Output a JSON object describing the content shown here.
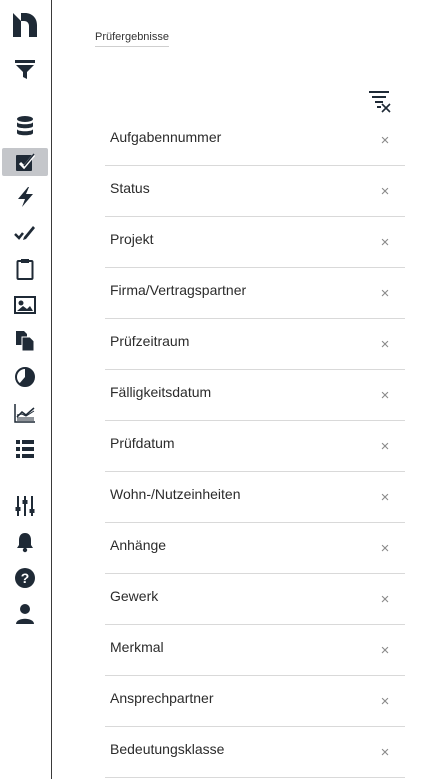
{
  "page": {
    "title": "Prüfergebnisse"
  },
  "icons": {
    "logo": "logo-n-icon",
    "filter": "funnel-filter-icon",
    "database": "database-icon",
    "tasks": "checkbox-icon",
    "lightning": "lightning-icon",
    "pen": "pen-check-icon",
    "clipboard": "clipboard-icon",
    "image": "image-card-icon",
    "documents": "documents-icon",
    "pie": "pie-chart-icon",
    "area": "area-chart-icon",
    "list": "list-icon",
    "sliders": "sliders-icon",
    "bell": "bell-icon",
    "help": "help-icon",
    "user": "user-icon",
    "clear_filter": "clear-filter-icon",
    "remove": "close-icon"
  },
  "colors": {
    "active_bg": "#c4c6ca",
    "icon": "#1f2a36"
  },
  "filters": [
    {
      "label": "Aufgabennummer",
      "remove": "×"
    },
    {
      "label": "Status",
      "remove": "×"
    },
    {
      "label": "Projekt",
      "remove": "×"
    },
    {
      "label": "Firma/Vertragspartner",
      "remove": "×"
    },
    {
      "label": "Prüfzeitraum",
      "remove": "×"
    },
    {
      "label": "Fälligkeitsdatum",
      "remove": "×"
    },
    {
      "label": "Prüfdatum",
      "remove": "×"
    },
    {
      "label": "Wohn-/Nutzeinheiten",
      "remove": "×"
    },
    {
      "label": "Anhänge",
      "remove": "×"
    },
    {
      "label": "Gewerk",
      "remove": "×"
    },
    {
      "label": "Merkmal",
      "remove": "×"
    },
    {
      "label": "Ansprechpartner",
      "remove": "×"
    },
    {
      "label": "Bedeutungsklasse",
      "remove": "×"
    }
  ]
}
